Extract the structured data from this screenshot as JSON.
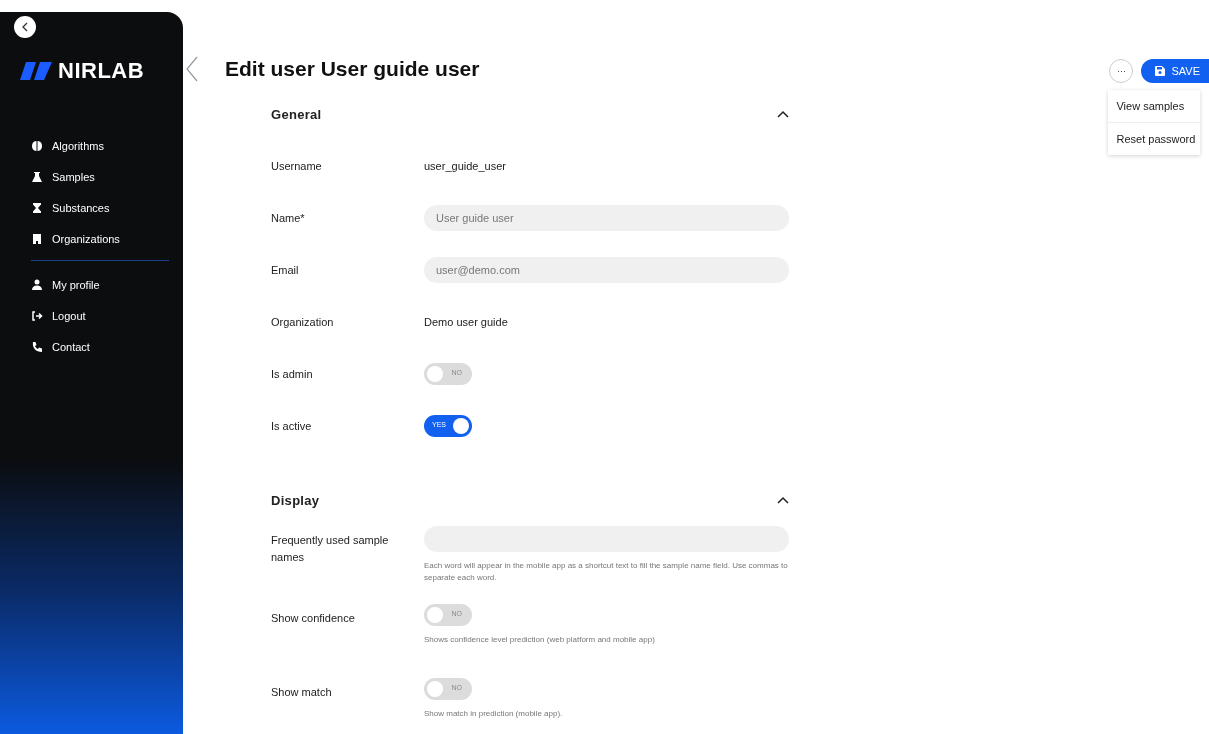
{
  "sidebar": {
    "logo": "NIRLAB",
    "nav_groups": [
      [
        {
          "label": "Algorithms"
        },
        {
          "label": "Samples"
        },
        {
          "label": "Substances"
        },
        {
          "label": "Organizations"
        }
      ],
      [
        {
          "label": "My profile"
        },
        {
          "label": "Logout"
        },
        {
          "label": "Contact"
        }
      ]
    ]
  },
  "title": "Edit user User guide user",
  "actions": {
    "more": "···",
    "save": "SAVE",
    "menu": [
      "View samples",
      "Reset password"
    ]
  },
  "sections": [
    {
      "title": "General",
      "expanded": true,
      "fields": [
        {
          "kind": "text",
          "label": "Username",
          "value": "user_guide_user"
        },
        {
          "kind": "input",
          "label": "Name*",
          "value": "User guide user"
        },
        {
          "kind": "input",
          "label": "Email",
          "value": "user@demo.com"
        },
        {
          "kind": "text",
          "label": "Organization",
          "value": "Demo user guide"
        },
        {
          "kind": "toggle",
          "label": "Is admin",
          "on": false,
          "state_label": "NO"
        },
        {
          "kind": "toggle",
          "label": "Is active",
          "on": true,
          "state_label": "YES"
        }
      ]
    },
    {
      "title": "Display",
      "expanded": true,
      "fields": [
        {
          "kind": "input",
          "label": "Frequently used sample names",
          "hint": "Each word will appear in the mobile app as a shortcut text to fill the sample name field. Use commas to separate each word."
        },
        {
          "kind": "toggle",
          "label": "Show confidence",
          "on": false,
          "state_label": "NO",
          "hint": "Shows confidence level prediction (web platform and mobile app)"
        },
        {
          "kind": "toggle",
          "label": "Show match",
          "on": false,
          "state_label": "NO",
          "hint": "Show match in prediction (mobile app)."
        }
      ]
    }
  ]
}
